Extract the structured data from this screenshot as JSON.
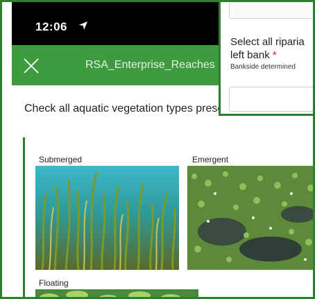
{
  "status_bar": {
    "time": "12:06",
    "location_icon": "location-arrow-icon"
  },
  "header": {
    "title": "RSA_Enterprise_Reaches",
    "close_icon": "close-icon",
    "color": "#3e9a3e"
  },
  "question": {
    "text": "Check all aquatic vegetation types present.",
    "required_marker": "*"
  },
  "vegetation_options": [
    {
      "label": "Submerged"
    },
    {
      "label": "Emergent"
    },
    {
      "label": "Floating"
    }
  ],
  "overlay": {
    "question_line1": "Select all riparia",
    "question_line2": "left bank",
    "required_marker": "*",
    "hint": "Bankside determined"
  },
  "colors": {
    "frame_green": "#2e7d32",
    "required_red": "#c62828"
  }
}
